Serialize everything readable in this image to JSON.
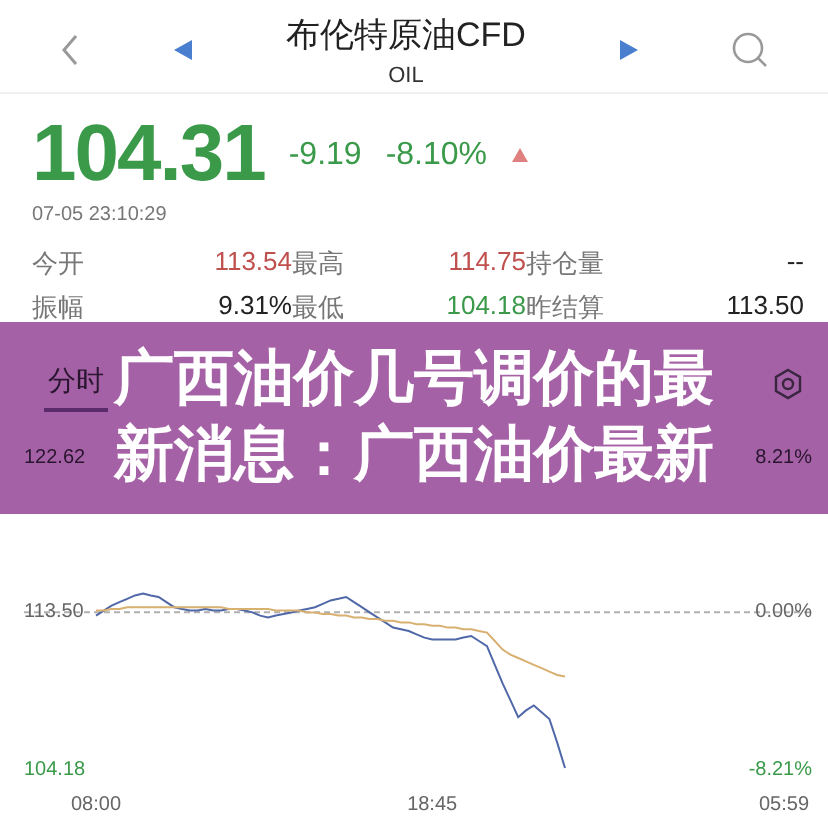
{
  "header": {
    "title": "布伦特原油CFD",
    "subtitle": "OIL"
  },
  "quote": {
    "price": "104.31",
    "change": "-9.19",
    "change_percent": "-8.10%",
    "time": "07-05 23:10:29"
  },
  "stats": [
    {
      "label": "今开",
      "value": "113.54",
      "color": "#c0504d"
    },
    {
      "label": "最高",
      "value": "114.75",
      "color": "#c0504d"
    },
    {
      "label": "持仓量",
      "value": "--",
      "color": "#222222"
    },
    {
      "label": "振幅",
      "value": "9.31%",
      "color": "#222222"
    },
    {
      "label": "最低",
      "value": "104.18",
      "color": "#3a9a4a"
    },
    {
      "label": "昨结算",
      "value": "113.50",
      "color": "#222222"
    }
  ],
  "tabs": [
    {
      "label": "分时",
      "selected": true
    }
  ],
  "chart_data": {
    "type": "line",
    "categories": [
      "08:00",
      null,
      null,
      null,
      null,
      null,
      null,
      null,
      null,
      null,
      null,
      null,
      null,
      null,
      null,
      null,
      null,
      null,
      null,
      null,
      null,
      null,
      null,
      null,
      null,
      null,
      null,
      null,
      null,
      null,
      null,
      null,
      null,
      null,
      null,
      null,
      null,
      null,
      null,
      null,
      null,
      null,
      null,
      "18:45",
      null,
      null,
      null,
      null,
      null,
      null,
      null,
      null,
      null,
      null,
      null,
      null,
      null,
      null,
      null,
      null,
      null,
      null,
      null,
      null,
      null,
      null,
      null,
      null,
      null,
      null,
      null,
      null,
      null,
      null,
      null,
      null,
      null,
      null,
      null,
      null,
      null,
      null,
      null,
      null,
      null,
      null,
      null,
      null,
      "05:59"
    ],
    "ylim": [
      104.18,
      122.62
    ],
    "yticks": [
      {
        "value": 122.62,
        "label": "122.62"
      },
      {
        "value": 113.5,
        "label": "113.50"
      },
      {
        "value": 104.18,
        "label": "104.18"
      }
    ],
    "series": [
      {
        "color": "#5068a8",
        "values": [
          113.3,
          113.6,
          113.9,
          114.1,
          114.3,
          114.5,
          114.6,
          114.5,
          114.4,
          114.1,
          113.8,
          113.7,
          113.6,
          113.6,
          113.7,
          113.6,
          113.6,
          113.7,
          113.7,
          113.6,
          113.5,
          113.3,
          113.2,
          113.3,
          113.4,
          113.5,
          113.6,
          113.7,
          113.8,
          114.0,
          114.2,
          114.3,
          114.4,
          114.1,
          113.8,
          113.5,
          113.2,
          112.9,
          112.6,
          112.5,
          112.4,
          112.2,
          112.0,
          111.9,
          111.9,
          111.9,
          111.9,
          112.0,
          112.1,
          111.8,
          111.5,
          110.4,
          109.3,
          108.3,
          107.3,
          107.7,
          108.0,
          107.6,
          107.2,
          105.8,
          104.3,
          null,
          null,
          null,
          null,
          null,
          null,
          null,
          null,
          null,
          null,
          null,
          null,
          null,
          null,
          null,
          null,
          null,
          null,
          null,
          null,
          null,
          null,
          null,
          null,
          null,
          null,
          null,
          null
        ]
      },
      {
        "color": "#d8b070",
        "values": [
          113.6,
          113.6,
          113.7,
          113.7,
          113.8,
          113.8,
          113.8,
          113.8,
          113.8,
          113.8,
          113.8,
          113.8,
          113.8,
          113.8,
          113.8,
          113.8,
          113.8,
          113.7,
          113.7,
          113.7,
          113.7,
          113.7,
          113.7,
          113.6,
          113.6,
          113.6,
          113.6,
          113.5,
          113.5,
          113.4,
          113.4,
          113.3,
          113.3,
          113.2,
          113.2,
          113.1,
          113.1,
          113.0,
          113.0,
          112.9,
          112.9,
          112.8,
          112.8,
          112.7,
          112.7,
          112.6,
          112.6,
          112.5,
          112.5,
          112.4,
          112.3,
          111.8,
          111.3,
          111.0,
          110.8,
          110.6,
          110.4,
          110.2,
          110.0,
          109.8,
          109.7,
          null,
          null,
          null,
          null,
          null,
          null,
          null,
          null,
          null,
          null,
          null,
          null,
          null,
          null,
          null,
          null,
          null,
          null,
          null,
          null,
          null,
          null,
          null,
          null,
          null,
          null,
          null,
          null
        ]
      }
    ]
  },
  "right_axis_labels": [
    "8.21%",
    "0.00%",
    "-8.21%"
  ],
  "banner": {
    "lines": [
      "广西油价几号调价的最",
      "新消息：广西油价最新"
    ]
  }
}
